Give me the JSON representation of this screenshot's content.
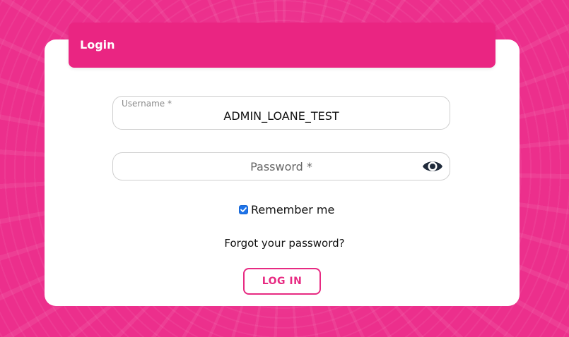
{
  "header": {
    "title": "Login"
  },
  "form": {
    "username": {
      "label": "Username *",
      "value": "ADMIN_LOANE_TEST"
    },
    "password": {
      "placeholder": "Password *",
      "toggle_icon": "eye-icon"
    },
    "remember": {
      "label": "Remember me",
      "checked": true
    },
    "forgot_label": "Forgot your password?",
    "login_label": "LOG IN"
  },
  "colors": {
    "background": "#ec2f8c",
    "header": "#ea2582",
    "accent": "#e72a82",
    "checkbox": "#1e73e8"
  }
}
